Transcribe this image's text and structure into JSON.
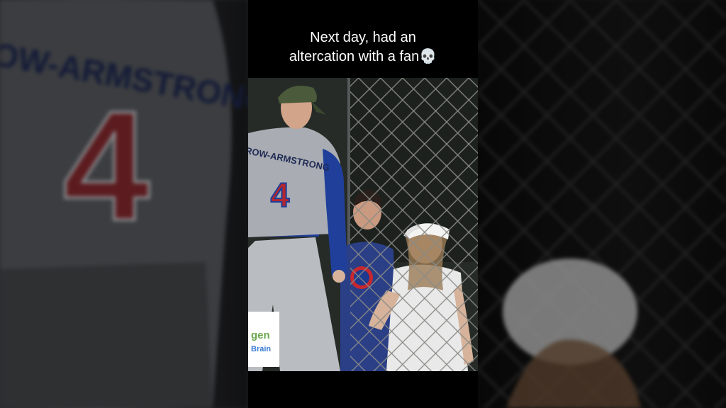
{
  "caption": {
    "line1": "Next day, had an",
    "line2": "altercation with a fan",
    "emoji": "💀"
  },
  "player": {
    "jersey_name": "CROW-ARMSTRONG",
    "jersey_number": "4"
  },
  "sponsor": {
    "text1": "gen",
    "text2": "Brain"
  },
  "colors": {
    "jersey_gray": "#a9adb3",
    "number_red": "#b4262e",
    "trim_blue": "#1f3f9a",
    "cap_green": "#4a5a3a",
    "fan_hat": "#f2f2f2"
  }
}
